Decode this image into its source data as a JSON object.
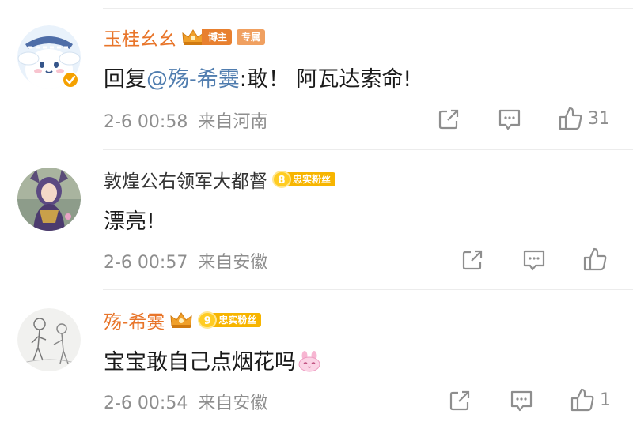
{
  "comments": [
    {
      "username": "玉桂幺幺",
      "badges": {
        "blogger": "博主",
        "exclusive": "专属"
      },
      "text": {
        "reply_prefix": "回复",
        "mention": "@殇-希霙",
        "body": ":敢！ 阿瓦达索命!"
      },
      "time": "2-6 00:58",
      "location": "来自河南",
      "likes": "31",
      "verified": true
    },
    {
      "username": "敦煌公右领军大都督",
      "fan_badge": {
        "level": "8",
        "label": "忠实粉丝"
      },
      "text": {
        "body": "漂亮!"
      },
      "time": "2-6 00:57",
      "location": "来自安徽",
      "likes": ""
    },
    {
      "username": "殇-希霙",
      "fan_badge": {
        "level": "9",
        "label": "忠实粉丝"
      },
      "text": {
        "body": "宝宝敢自己点烟花吗"
      },
      "time": "2-6 00:54",
      "location": "来自安徽",
      "likes": "1"
    }
  ],
  "icons": {
    "share": "share-icon",
    "comment": "comment-icon",
    "like": "thumbs-up-icon",
    "crown": "crown-icon",
    "verified": "verified-icon",
    "emoji": "bunny-emoji-icon"
  },
  "colors": {
    "username_highlight": "#e8752a",
    "mention": "#507daf",
    "meta_gray": "#8e8e8e",
    "fan_gold": "#f7b500"
  }
}
